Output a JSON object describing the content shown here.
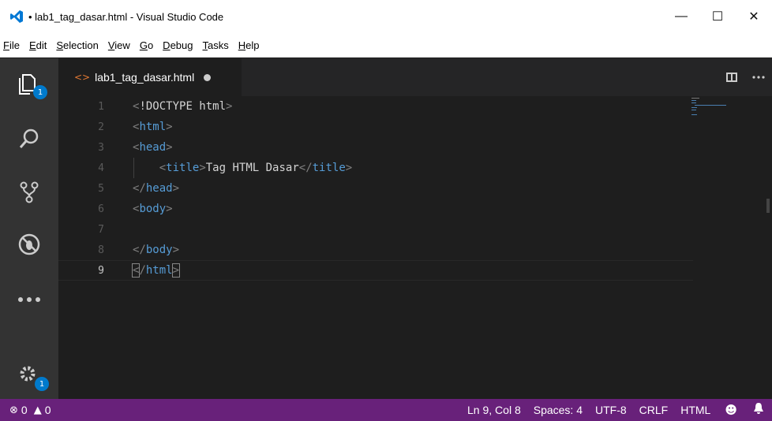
{
  "window": {
    "title": "• lab1_tag_dasar.html - Visual Studio Code",
    "controls": {
      "minimize": "—",
      "maximize": "☐",
      "close": "✕"
    }
  },
  "menu": {
    "items": [
      {
        "label": "File",
        "mnemonic": "F"
      },
      {
        "label": "Edit",
        "mnemonic": "E"
      },
      {
        "label": "Selection",
        "mnemonic": "S"
      },
      {
        "label": "View",
        "mnemonic": "V"
      },
      {
        "label": "Go",
        "mnemonic": "G"
      },
      {
        "label": "Debug",
        "mnemonic": "D"
      },
      {
        "label": "Tasks",
        "mnemonic": "T"
      },
      {
        "label": "Help",
        "mnemonic": "H"
      }
    ]
  },
  "activity_bar": {
    "explorer_badge": "1",
    "settings_badge": "1",
    "icons": [
      "explorer-icon",
      "search-icon",
      "source-control-icon",
      "debug-icon",
      "more-icon",
      "settings-gear-icon"
    ]
  },
  "tab": {
    "label": "lab1_tag_dasar.html",
    "icon": "html-file-icon",
    "dirty": true
  },
  "editor": {
    "current_line": 9,
    "lines": [
      {
        "num": "1",
        "text": "<!DOCTYPE html>"
      },
      {
        "num": "2",
        "text": "<html>"
      },
      {
        "num": "3",
        "text": "<head>"
      },
      {
        "num": "4",
        "text": "    <title>Tag HTML Dasar</title>"
      },
      {
        "num": "5",
        "text": "</head>"
      },
      {
        "num": "6",
        "text": "<body>"
      },
      {
        "num": "7",
        "text": ""
      },
      {
        "num": "8",
        "text": "</body>"
      },
      {
        "num": "9",
        "text": "</html>"
      }
    ]
  },
  "status": {
    "errors": "0",
    "warnings": "0",
    "position": "Ln 9, Col 8",
    "spaces": "Spaces: 4",
    "encoding": "UTF-8",
    "eol": "CRLF",
    "language": "HTML"
  },
  "colors": {
    "statusbar": "#68217a",
    "activitybar": "#333333",
    "editor_bg": "#1e1e1e",
    "tag": "#569cd6",
    "badge": "#007acc"
  }
}
